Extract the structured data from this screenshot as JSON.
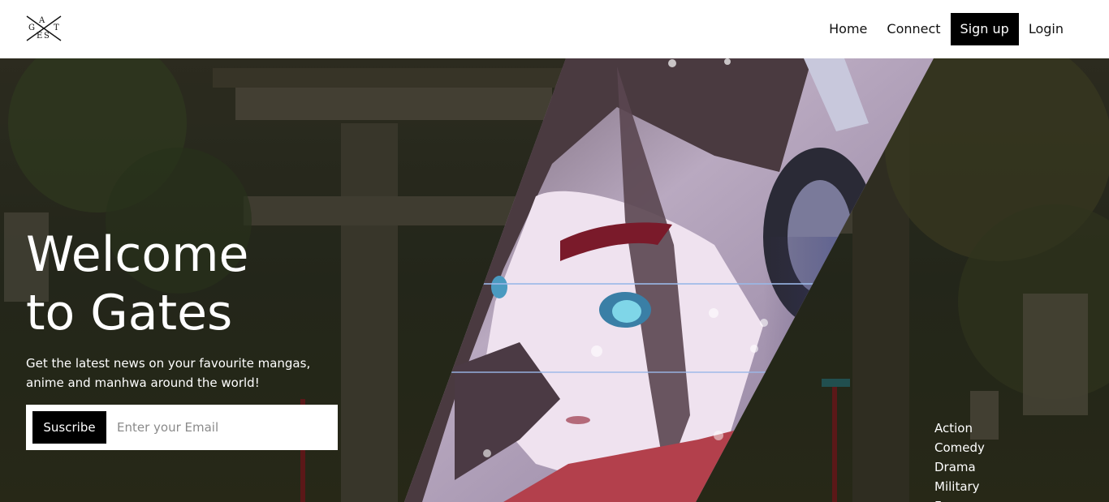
{
  "header": {
    "logo": {
      "letters": [
        "G",
        "A",
        "T",
        "E",
        "S"
      ]
    },
    "nav": [
      {
        "label": "Home"
      },
      {
        "label": "Connect"
      },
      {
        "label": "Sign up"
      },
      {
        "label": "Login"
      }
    ]
  },
  "hero": {
    "title_line1": "Welcome",
    "title_line2": "to Gates",
    "subtitle": "Get the latest news on your favourite mangas, anime and manhwa around the world!",
    "subscribe_button": "Suscribe",
    "email_placeholder": "Enter your Email",
    "genres": [
      "Action",
      "Comedy",
      "Drama",
      "Military",
      "F"
    ]
  },
  "colors": {
    "black": "#000000",
    "white": "#ffffff"
  }
}
